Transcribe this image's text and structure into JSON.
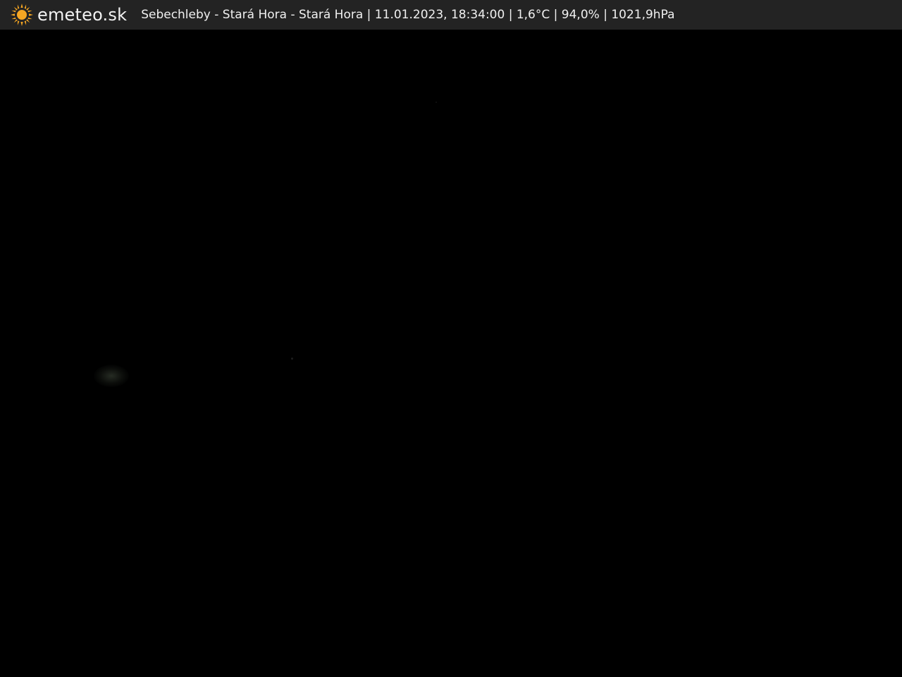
{
  "overlay": {
    "logo": {
      "icon": "sun-icon",
      "text": "emeteo.sk",
      "color": "#f5a623"
    },
    "caption": "Sebechleby - Stará Hora - Stará Hora | 11.01.2023, 18:34:00 | 1,6°C | 94,0% | 1021,9hPa"
  },
  "colors": {
    "bar_background": "#232323",
    "scene_background": "#000000"
  }
}
